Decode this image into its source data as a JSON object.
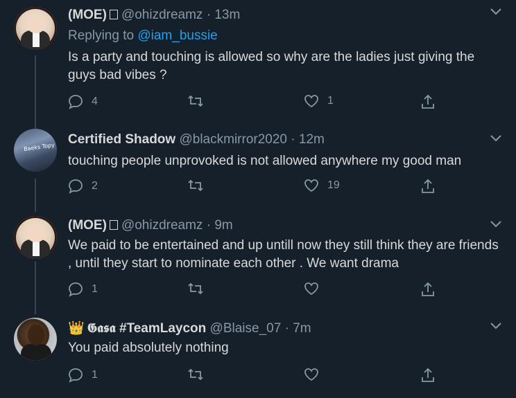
{
  "tweets": [
    {
      "name": "(MOE)",
      "handle": "@ohizdreamz",
      "dot": "·",
      "time": "13m",
      "reply_prefix": "Replying to",
      "reply_to": "@iam_bussie",
      "text": "Is a party and touching is allowed so why are the ladies just giving the guys bad vibes ?",
      "reply_count": "4",
      "retweet_count": "",
      "like_count": "1"
    },
    {
      "name": "Certified Shadow",
      "handle": "@blackmirror2020",
      "dot": "·",
      "time": "12m",
      "avatar_text": "Baeks Topy",
      "text": "touching people unprovoked is not allowed anywhere my good man",
      "reply_count": "2",
      "retweet_count": "",
      "like_count": "19"
    },
    {
      "name": "(MOE)",
      "handle": "@ohizdreamz",
      "dot": "·",
      "time": "9m",
      "text": "We paid to be entertained and up untill now they still think they are friends , until they start to nominate each other . We want drama",
      "reply_count": "1",
      "retweet_count": "",
      "like_count": ""
    },
    {
      "name": "𝕲𝖆𝖘𝖆 #TeamLaycon",
      "crown": "👑",
      "handle": "@Blaise_07",
      "dot": "·",
      "time": "7m",
      "text": "You paid absolutely nothing",
      "reply_count": "1",
      "retweet_count": "",
      "like_count": ""
    }
  ],
  "colors": {
    "background": "#15202b",
    "text": "#d9d9d9",
    "muted": "#8899a6",
    "link": "#1da1f2",
    "thread_line": "#38444d"
  },
  "icons": {
    "reply": "reply-icon",
    "retweet": "retweet-icon",
    "like": "heart-icon",
    "share": "share-icon",
    "more": "chevron-down-icon"
  }
}
